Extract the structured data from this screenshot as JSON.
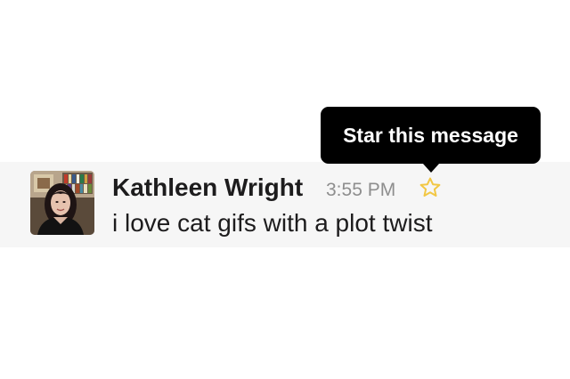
{
  "tooltip": {
    "text": "Star this message"
  },
  "message": {
    "sender": "Kathleen Wright",
    "timestamp": "3:55 PM",
    "text": "i love cat gifs with a plot twist",
    "avatar_icon": "user-avatar-photo",
    "star_icon": "star-outline-icon",
    "star_color": "#f2c744"
  },
  "colors": {
    "row_background": "#f6f6f6",
    "tooltip_background": "#000000",
    "text_primary": "#1d1c1d",
    "text_muted": "#8e8e8e"
  }
}
